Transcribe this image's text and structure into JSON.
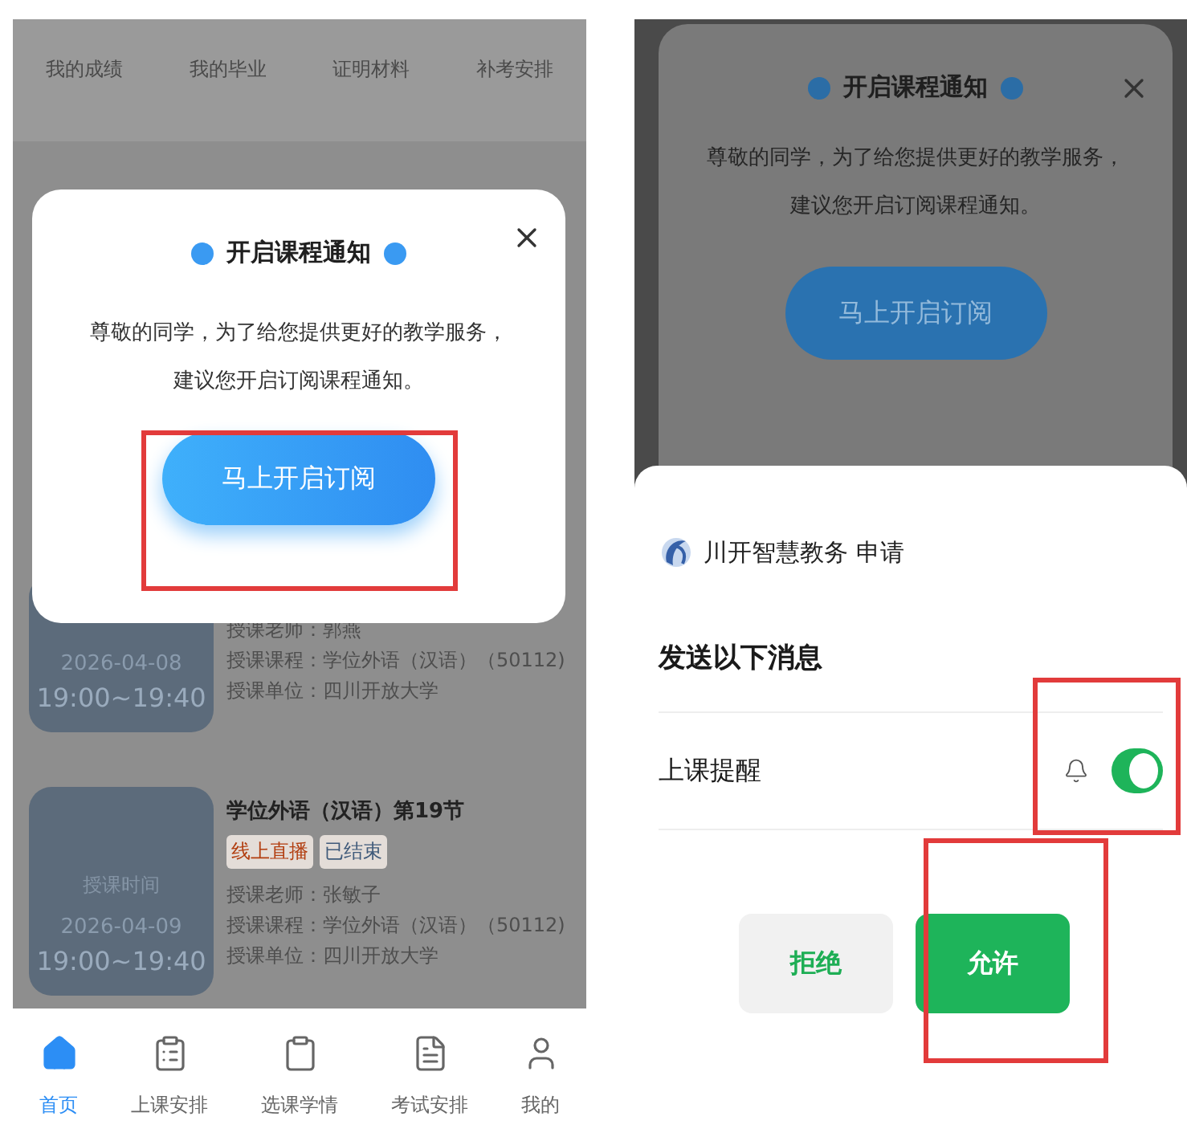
{
  "left_screen": {
    "quick_links": [
      "我的成绩",
      "我的毕业",
      "证明材料",
      "补考安排"
    ],
    "courses": [
      {
        "date": "2026-04-08",
        "time": "19:00~19:40",
        "teacher": "授课老师：郭燕",
        "course": "授课课程：学位外语（汉语）（50112)",
        "unit": "授课单位：四川开放大学"
      },
      {
        "time_label": "授课时间",
        "date": "2026-04-09",
        "time": "19:00~19:40",
        "title": "学位外语（汉语）第19节",
        "tags": [
          {
            "label": "线上直播",
            "color": "#b23e10"
          },
          {
            "label": "已结束",
            "color": "#3f5a7a"
          }
        ],
        "teacher": "授课老师：张敏子",
        "course": "授课课程：学位外语（汉语）（50112)",
        "unit": "授课单位：四川开放大学"
      }
    ],
    "dialog": {
      "title": "开启课程通知",
      "message_lines": [
        "尊敬的同学，为了给您提供更好的教学服务，",
        "建议您开启订阅课程通知。"
      ],
      "button": "马上开启订阅"
    },
    "tab_bar": [
      {
        "label": "首页",
        "selected": true
      },
      {
        "label": "上课安排",
        "selected": false
      },
      {
        "label": "选课学情",
        "selected": false
      },
      {
        "label": "考试安排",
        "selected": false
      },
      {
        "label": "我的",
        "selected": false
      }
    ]
  },
  "right_screen": {
    "dialog": {
      "title": "开启课程通知",
      "message_lines": [
        "尊敬的同学，为了给您提供更好的教学服务，",
        "建议您开启订阅课程通知。"
      ],
      "button": "马上开启订阅"
    },
    "sheet": {
      "app_name": "川开智慧教务",
      "action": "申请",
      "heading": "发送以下消息",
      "items": [
        {
          "label": "上课提醒",
          "on": true
        }
      ],
      "buttons": [
        {
          "label": "拒绝",
          "kind": "secondary"
        },
        {
          "label": "允许",
          "kind": "primary"
        }
      ]
    }
  }
}
